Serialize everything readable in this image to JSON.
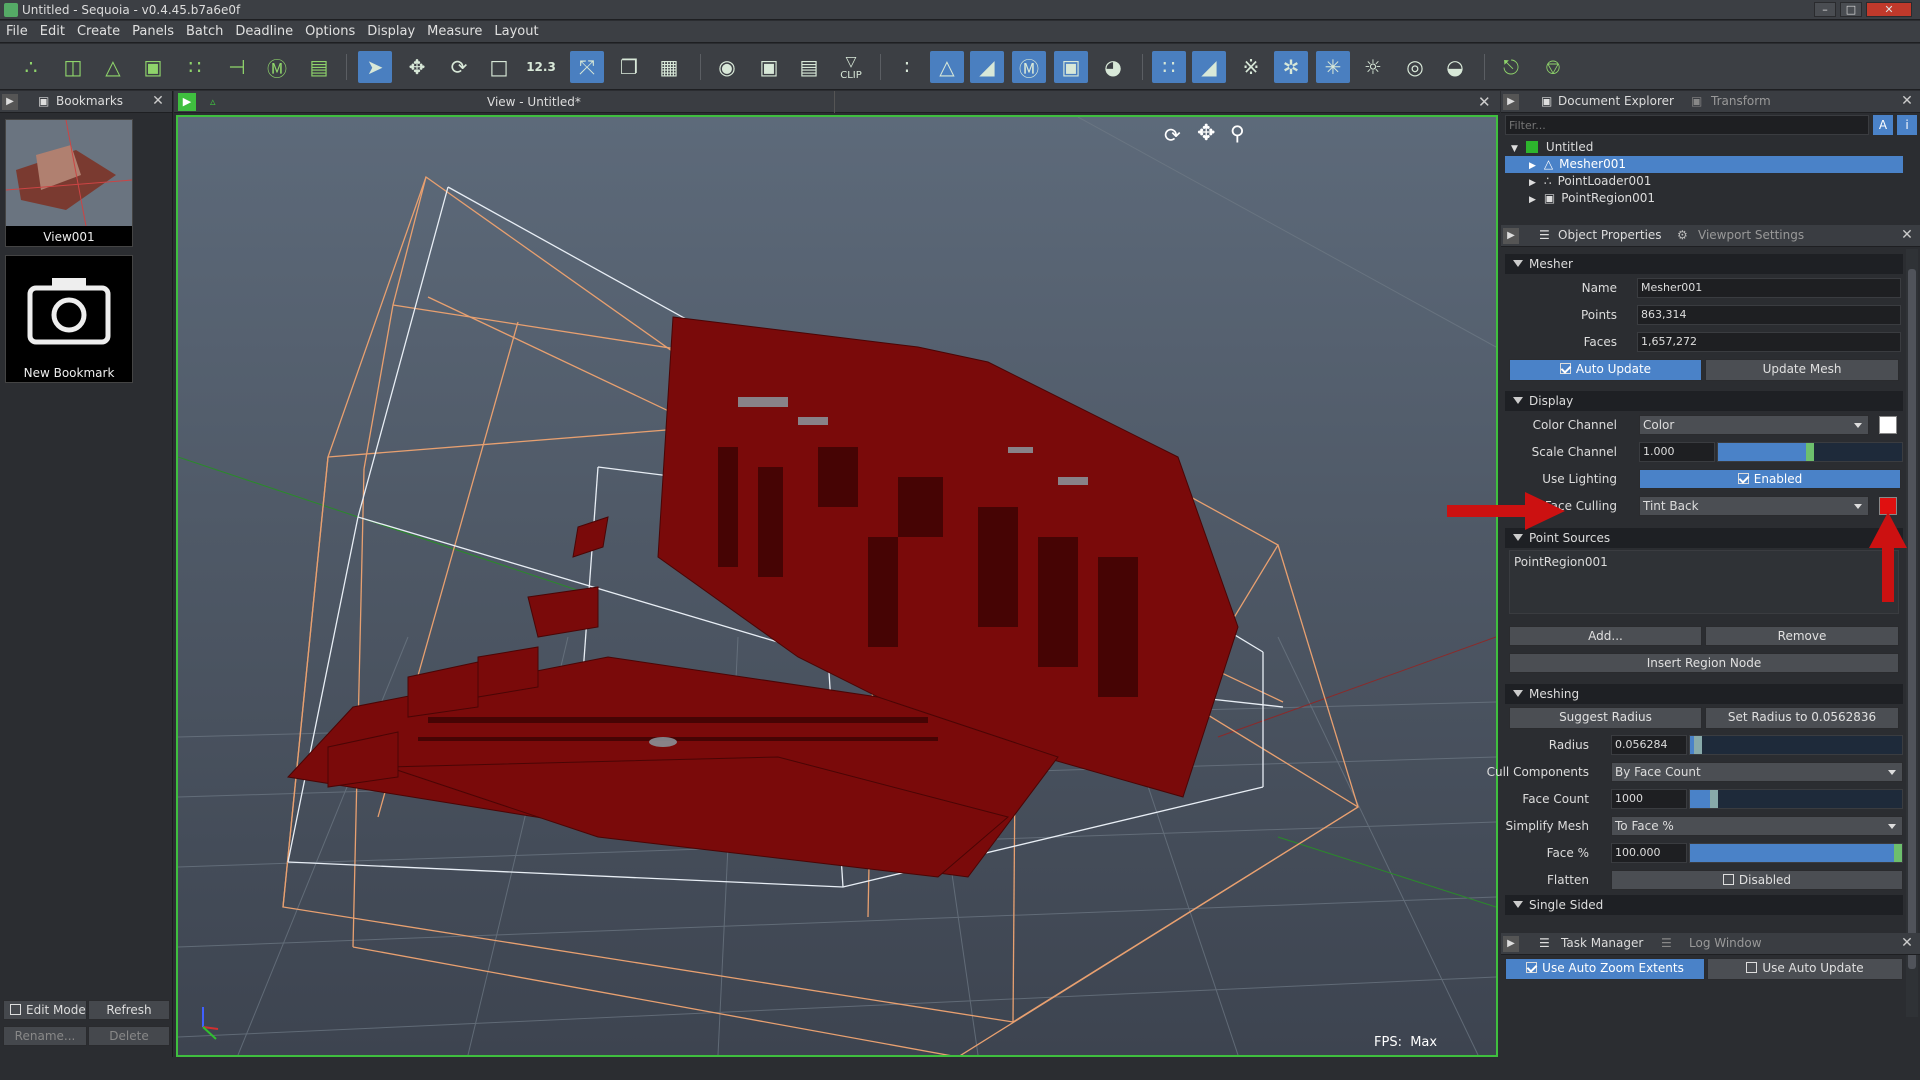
{
  "window": {
    "title": "Untitled - Sequoia - v0.4.45.b7a6e0f"
  },
  "menu": [
    "File",
    "Edit",
    "Create",
    "Panels",
    "Batch",
    "Deadline",
    "Options",
    "Display",
    "Measure",
    "Layout"
  ],
  "toolbar": {
    "icons": [
      "point-loader",
      "region-add",
      "mesher-add",
      "region-alt",
      "mesher-alt",
      "merge",
      "mesher-m",
      "camera-add",
      "select",
      "move",
      "rotate",
      "scale",
      "measure",
      "axis",
      "box-view",
      "grid",
      "frame",
      "render",
      "frustum",
      "clip",
      "points",
      "mesh-tri",
      "mesh-x",
      "mesh-m",
      "mesh-cam",
      "camera",
      "pts-grid",
      "mesh-wire",
      "pts-dense",
      "mesh-light",
      "pts-light",
      "light",
      "sphere",
      "shade",
      "ground",
      "origin"
    ],
    "measure_label": "12.3",
    "clip_label": "CLIP"
  },
  "bookmarks": {
    "tab": "Bookmarks",
    "items": [
      {
        "label": "View001"
      },
      {
        "label": "New Bookmark"
      }
    ],
    "edit_mode": "Edit Mode",
    "refresh": "Refresh",
    "rename": "Rename...",
    "delete": "Delete"
  },
  "viewport": {
    "title": "View - Untitled*",
    "fps_label": "FPS:",
    "fps_value": "Max"
  },
  "explorer": {
    "tab_active": "Document Explorer",
    "tab_inactive": "Transform",
    "filter_placeholder": "Filter...",
    "root": "Untitled",
    "items": [
      "Mesher001",
      "PointLoader001",
      "PointRegion001"
    ]
  },
  "props": {
    "tab_active": "Object Properties",
    "tab_inactive": "Viewport Settings",
    "mesher_header": "Mesher",
    "name_label": "Name",
    "name_value": "Mesher001",
    "points_label": "Points",
    "points_value": "863,314",
    "faces_label": "Faces",
    "faces_value": "1,657,272",
    "auto_update": "Auto Update",
    "update_mesh": "Update Mesh",
    "display_header": "Display",
    "color_channel_label": "Color Channel",
    "color_channel_value": "Color",
    "scale_channel_label": "Scale Channel",
    "scale_channel_value": "1.000",
    "scale_fill": 0.5,
    "use_lighting_label": "Use Lighting",
    "use_lighting_value": "Enabled",
    "face_culling_label": "Face Culling",
    "face_culling_value": "Tint Back",
    "point_sources_header": "Point Sources",
    "point_sources": [
      "PointRegion001"
    ],
    "add": "Add...",
    "remove": "Remove",
    "insert_region": "Insert Region Node",
    "meshing_header": "Meshing",
    "suggest_radius": "Suggest Radius",
    "set_radius": "Set Radius to 0.0562836",
    "radius_label": "Radius",
    "radius_value": "0.056284",
    "radius_fill": 0.02,
    "cull_label": "Cull Components",
    "cull_value": "By Face Count",
    "face_count_label": "Face Count",
    "face_count_value": "1000",
    "face_count_fill": 0.1,
    "simplify_label": "Simplify Mesh",
    "simplify_value": "To Face %",
    "face_pct_label": "Face %",
    "face_pct_value": "100.000",
    "face_pct_fill": 1.0,
    "flatten_label": "Flatten",
    "flatten_value": "Disabled",
    "single_sided_header": "Single Sided"
  },
  "tasks": {
    "tab_active": "Task Manager",
    "tab_inactive": "Log Window",
    "auto_zoom": "Use Auto Zoom Extents",
    "auto_update": "Use Auto Update"
  },
  "colors": {
    "accent": "#4a82c8",
    "mesh": "#7a0a0a",
    "viewport_border": "#3fbf3f",
    "arrow": "#cc1111"
  }
}
